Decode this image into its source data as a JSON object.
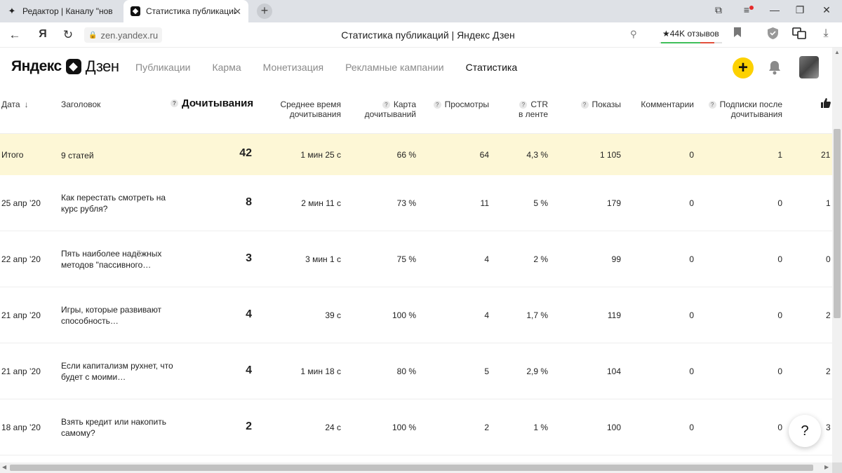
{
  "browser": {
    "tabs": [
      {
        "label": "Редактор | Каналу \"новичок\""
      },
      {
        "label": "Статистика публикаций"
      }
    ],
    "url": "zen.yandex.ru",
    "page_title": "Статистика публикаций | Яндекс Дзен",
    "reviews_label": "★44K отзывов"
  },
  "site": {
    "logo_brand": "Яндекс",
    "logo_product": "Дзен",
    "menu": [
      {
        "label": "Публикации"
      },
      {
        "label": "Карма"
      },
      {
        "label": "Монетизация"
      },
      {
        "label": "Рекламные кампании"
      },
      {
        "label": "Статистика"
      }
    ],
    "active_menu": "Статистика",
    "accent_color": "#fdd100"
  },
  "table": {
    "headers": {
      "date": "Дата",
      "title": "Заголовок",
      "reads": "Дочитывания",
      "avg_time_1": "Среднее время",
      "avg_time_2": "дочитывания",
      "map_1": "Карта",
      "map_2": "дочитываний",
      "views": "Просмотры",
      "ctr_1": "CTR",
      "ctr_2": "в ленте",
      "impressions": "Показы",
      "comments": "Комментарии",
      "subs_1": "Подписки после",
      "subs_2": "дочитывания"
    },
    "total": {
      "date": "Итого",
      "title": "9 статей",
      "reads": "42",
      "avg_time": "1 мин 25 с",
      "map": "66 %",
      "views": "64",
      "ctr": "4,3 %",
      "impressions": "1 105",
      "comments": "0",
      "subs": "1",
      "likes": "21"
    },
    "rows": [
      {
        "date": "25 апр ’20",
        "title": "Как перестать смотреть на курс рубля?",
        "reads": "8",
        "avg_time": "2 мин 11 с",
        "map": "73 %",
        "views": "11",
        "ctr": "5 %",
        "impressions": "179",
        "comments": "0",
        "subs": "0",
        "likes": "1"
      },
      {
        "date": "22 апр ’20",
        "title": "Пять наиболее надёжных методов \"пассивного…",
        "reads": "3",
        "avg_time": "3 мин 1 с",
        "map": "75 %",
        "views": "4",
        "ctr": "2 %",
        "impressions": "99",
        "comments": "0",
        "subs": "0",
        "likes": "0"
      },
      {
        "date": "21 апр ’20",
        "title": "Игры, которые развивают способность…",
        "reads": "4",
        "avg_time": "39 с",
        "map": "100 %",
        "views": "4",
        "ctr": "1,7 %",
        "impressions": "119",
        "comments": "0",
        "subs": "0",
        "likes": "2"
      },
      {
        "date": "21 апр ’20",
        "title": "Если капитализм рухнет, что будет с моими…",
        "reads": "4",
        "avg_time": "1 мин 18 с",
        "map": "80 %",
        "views": "5",
        "ctr": "2,9 %",
        "impressions": "104",
        "comments": "0",
        "subs": "0",
        "likes": "2"
      },
      {
        "date": "18 апр ’20",
        "title": "Взять кредит или накопить самому?",
        "reads": "2",
        "avg_time": "24 с",
        "map": "100 %",
        "views": "2",
        "ctr": "1 %",
        "impressions": "100",
        "comments": "0",
        "subs": "0",
        "likes": "3"
      }
    ]
  },
  "help_label": "?"
}
